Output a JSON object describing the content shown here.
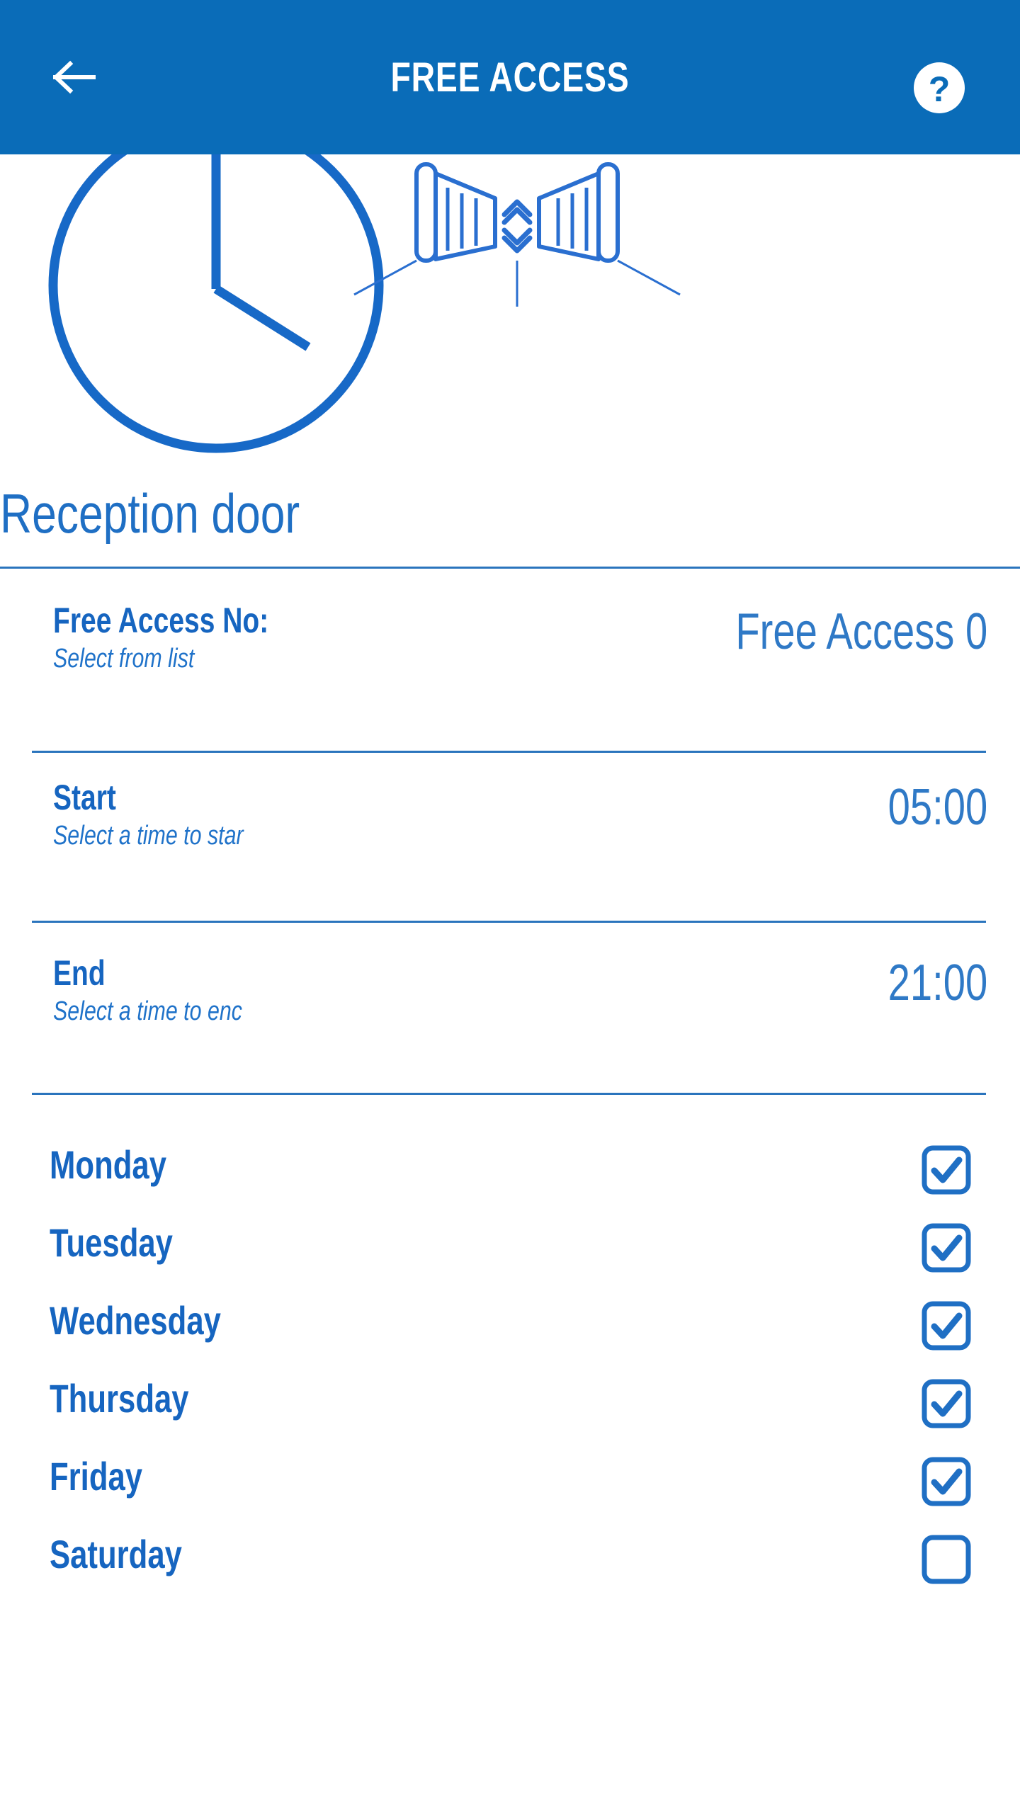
{
  "header": {
    "title": "FREE ACCESS",
    "back_icon": "arrow-left-icon",
    "help_icon": "help-circle-icon",
    "background_color": "#0a6cb8",
    "text_color": "#ffffff"
  },
  "hero": {
    "clock_icon": "clock-icon",
    "gate_icon": "opening-gate-icon",
    "accent_color": "#1f6fc4"
  },
  "device": {
    "title": "Reception door"
  },
  "settings": [
    {
      "label": "Free Access No:",
      "sub": "Select from list",
      "value": "Free Access 0"
    },
    {
      "label": "Start",
      "sub": "Select a time to star",
      "value": "05:00"
    },
    {
      "label": "End",
      "sub": "Select a time to enc",
      "value": "21:00"
    }
  ],
  "days": [
    {
      "label": "Monday",
      "checked": true
    },
    {
      "label": "Tuesday",
      "checked": true
    },
    {
      "label": "Wednesday",
      "checked": true
    },
    {
      "label": "Thursday",
      "checked": true
    },
    {
      "label": "Friday",
      "checked": true
    },
    {
      "label": "Saturday",
      "checked": false
    }
  ],
  "colors": {
    "brand_blue": "#0a6cb8",
    "text_blue": "#1665c0",
    "value_blue": "#2f79c6",
    "divider_blue": "#2a74bd",
    "page_background": "#ffffff"
  }
}
